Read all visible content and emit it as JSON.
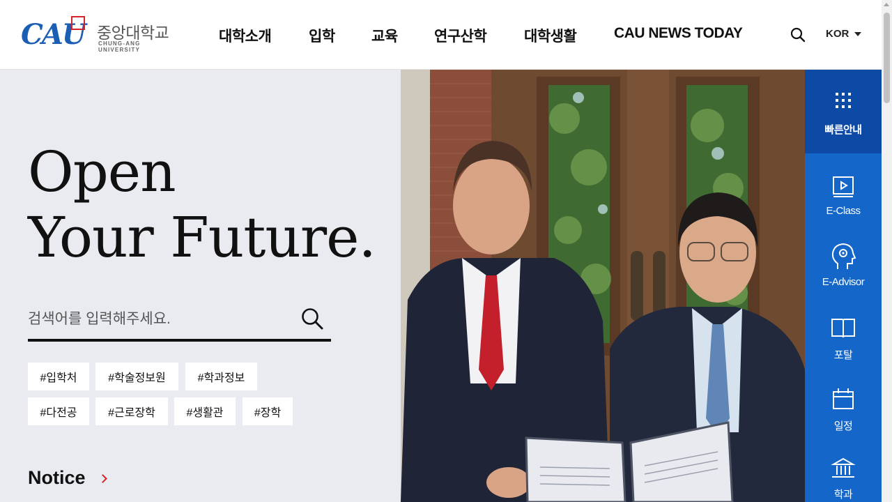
{
  "logo": {
    "mark": "CAU",
    "korean": "중앙대학교",
    "english": "CHUNG-ANG UNIVERSITY"
  },
  "nav": {
    "items": [
      {
        "label": "대학소개"
      },
      {
        "label": "입학"
      },
      {
        "label": "교육"
      },
      {
        "label": "연구산학"
      },
      {
        "label": "대학생활"
      },
      {
        "label": "CAU NEWS TODAY"
      }
    ],
    "language": "KOR"
  },
  "hero": {
    "title_line1": "Open",
    "title_line2": "Your Future.",
    "search_placeholder": "검색어를 입력해주세요.",
    "search_value": "",
    "tags": [
      "#입학처",
      "#학술정보원",
      "#학과정보",
      "#다전공",
      "#근로장학",
      "#생활관",
      "#장학"
    ],
    "notice": "Notice"
  },
  "quick_menu": {
    "title": "빠른안내",
    "items": [
      {
        "label": "E-Class",
        "icon": "play-screen-icon"
      },
      {
        "label": "E-Advisor",
        "icon": "head-gear-icon"
      },
      {
        "label": "포탈",
        "icon": "open-book-icon"
      },
      {
        "label": "일정",
        "icon": "calendar-icon"
      },
      {
        "label": "학과",
        "icon": "building-icon"
      }
    ]
  },
  "colors": {
    "brand_blue": "#1466c8",
    "dark_blue": "#0c4aa6",
    "accent_red": "#d4242a",
    "hero_bg": "#e9ebf1"
  }
}
